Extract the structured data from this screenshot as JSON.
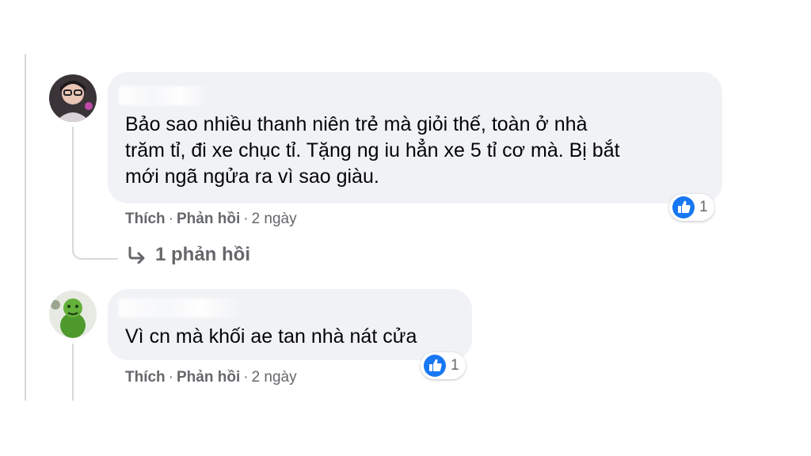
{
  "comments": [
    {
      "text": "Bảo sao nhiều thanh niên trẻ mà giỏi thế, toàn ở nhà\ntrăm tỉ, đi xe chục tỉ. Tặng ng iu hẳn xe 5 tỉ cơ mà. Bị bắt\nmới ngã ngửa ra vì sao giàu.",
      "like_label": "Thích",
      "reply_label": "Phản hồi",
      "time": "2 ngày",
      "reaction_count": "1",
      "replies_label": "1 phản hồi"
    },
    {
      "text": "Vì cn mà khối ae tan nhà nát cửa",
      "like_label": "Thích",
      "reply_label": "Phản hồi",
      "time": "2 ngày",
      "reaction_count": "1"
    }
  ],
  "separator": "·",
  "icons": {
    "like": "like-icon",
    "reply": "reply-arrow-icon"
  },
  "colors": {
    "bubble": "#f0f2f5",
    "meta": "#65676b",
    "like_blue": "#1877f2"
  }
}
